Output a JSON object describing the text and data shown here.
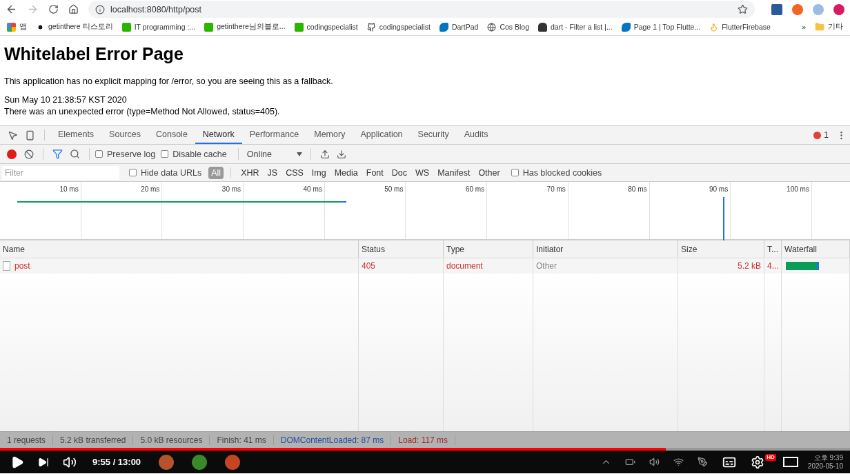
{
  "browser": {
    "url": "localhost:8080/http/post",
    "bookmarks": [
      {
        "label": "앱",
        "kind": "apps"
      },
      {
        "label": "getinthere 티스토리",
        "kind": "dots"
      },
      {
        "label": "IT programming :...",
        "kind": "blog"
      },
      {
        "label": "getinthere님의블로...",
        "kind": "blog"
      },
      {
        "label": "codingspecialist",
        "kind": "blog"
      },
      {
        "label": "codingspecialist",
        "kind": "github"
      },
      {
        "label": "DartPad",
        "kind": "dart"
      },
      {
        "label": "Cos Blog",
        "kind": "globe"
      },
      {
        "label": "dart - Filter a list |...",
        "kind": "person"
      },
      {
        "label": "Page 1 | Top Flutte...",
        "kind": "dart"
      },
      {
        "label": "FlutterFirebase",
        "kind": "fire"
      }
    ],
    "more": "»",
    "other_bookmarks": "기타"
  },
  "page": {
    "title": "Whitelabel Error Page",
    "message": "This application has no explicit mapping for /error, so you are seeing this as a fallback.",
    "date": "Sun May 10 21:38:57 KST 2020",
    "error": "There was an unexpected error (type=Method Not Allowed, status=405)."
  },
  "devtools": {
    "tabs": [
      {
        "label": "Elements",
        "selected": false
      },
      {
        "label": "Sources",
        "selected": false
      },
      {
        "label": "Console",
        "selected": false
      },
      {
        "label": "Network",
        "selected": true
      },
      {
        "label": "Performance",
        "selected": false
      },
      {
        "label": "Memory",
        "selected": false
      },
      {
        "label": "Application",
        "selected": false
      },
      {
        "label": "Security",
        "selected": false
      },
      {
        "label": "Audits",
        "selected": false
      }
    ],
    "error_count": "1",
    "recording": true,
    "preserve_log": {
      "label": "Preserve log",
      "checked": false
    },
    "disable_cache": {
      "label": "Disable cache",
      "checked": false
    },
    "throttling": "Online",
    "filter": {
      "placeholder": "Filter"
    },
    "hide_data_urls": {
      "label": "Hide data URLs",
      "checked": false
    },
    "types": [
      {
        "label": "All",
        "selected": true
      },
      {
        "label": "XHR",
        "selected": false
      },
      {
        "label": "JS",
        "selected": false
      },
      {
        "label": "CSS",
        "selected": false
      },
      {
        "label": "Img",
        "selected": false
      },
      {
        "label": "Media",
        "selected": false
      },
      {
        "label": "Font",
        "selected": false
      },
      {
        "label": "Doc",
        "selected": false
      },
      {
        "label": "WS",
        "selected": false
      },
      {
        "label": "Manifest",
        "selected": false
      },
      {
        "label": "Other",
        "selected": false
      }
    ],
    "blocked_cookies": {
      "label": "Has blocked cookies",
      "checked": false
    },
    "timeline_ticks": [
      "10 ms",
      "20 ms",
      "30 ms",
      "40 ms",
      "50 ms",
      "60 ms",
      "70 ms",
      "80 ms",
      "90 ms",
      "100 ms"
    ],
    "table": {
      "columns": [
        "Name",
        "Status",
        "Type",
        "Initiator",
        "Size",
        "T...",
        "Waterfall"
      ],
      "rows": [
        {
          "name": "post",
          "status": "405",
          "type": "document",
          "initiator": "Other",
          "size": "5.2 kB",
          "time": "4...",
          "failed": true
        }
      ]
    },
    "status_bar": [
      {
        "text": "1 requests",
        "kind": "plain"
      },
      {
        "text": "5.2 kB transferred",
        "kind": "plain"
      },
      {
        "text": "5.0 kB resources",
        "kind": "plain"
      },
      {
        "text": "Finish: 41 ms",
        "kind": "plain"
      },
      {
        "text": "DOMContentLoaded: 87 ms",
        "kind": "dom"
      },
      {
        "text": "Load: 117 ms",
        "kind": "load"
      }
    ]
  },
  "player": {
    "time": "9:55 / 13:00",
    "level": 0.783,
    "clock": "오후 9:39",
    "date": "2020-05-10",
    "hd": "HD"
  }
}
